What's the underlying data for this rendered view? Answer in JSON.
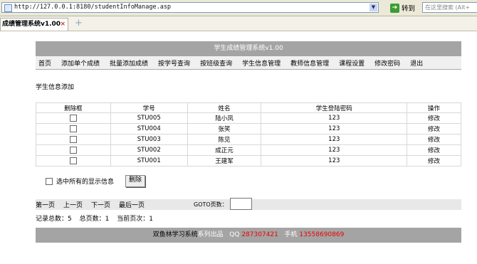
{
  "browser": {
    "url": "http://127.0.0.1:8180/studentInfoManage.asp",
    "go_label": "转到",
    "search_placeholder": "在这里搜索 (Alt+",
    "tab_title": "成绩管理系统v1.00",
    "tab_close": "×"
  },
  "header": {
    "title": "学生成绩管理系统v1.00"
  },
  "nav": [
    "首页",
    "添加单个成绩",
    "批量添加成绩",
    "按学号查询",
    "按班级查询",
    "学生信息管理",
    "教师信息管理",
    "课程设置",
    "修改密码",
    "退出"
  ],
  "section_title": "学生信息添加",
  "table": {
    "headers": [
      "删除框",
      "学号",
      "姓名",
      "学生登陆密码",
      "操作"
    ],
    "rows": [
      {
        "id": "STU005",
        "name": "陆小凤",
        "password": "123",
        "action": "修改"
      },
      {
        "id": "STU004",
        "name": "张笑",
        "password": "123",
        "action": "修改"
      },
      {
        "id": "STU003",
        "name": "陈见",
        "password": "123",
        "action": "修改"
      },
      {
        "id": "STU002",
        "name": "成正元",
        "password": "123",
        "action": "修改"
      },
      {
        "id": "STU001",
        "name": "王建军",
        "password": "123",
        "action": "修改"
      }
    ]
  },
  "select_all_label": "选中所有的显示信息",
  "delete_label": "删除",
  "pager": {
    "first": "第一页",
    "prev": "上一页",
    "next": "下一页",
    "last": "最后一页",
    "goto_label": "GOTO页数："
  },
  "stats": {
    "total_records": "记录总数：5",
    "total_pages": "总页数：1",
    "current_page": "当前页次：1"
  },
  "footer": {
    "left": "双鱼林学习系统",
    "mid": "系列出品",
    "qq_label": "QQ",
    "qq": "287307421",
    "phone_label": "手机",
    "phone": "13558690869"
  },
  "colors": {
    "header_bg": "#a4a4a4",
    "footer_red": "#e00000"
  }
}
